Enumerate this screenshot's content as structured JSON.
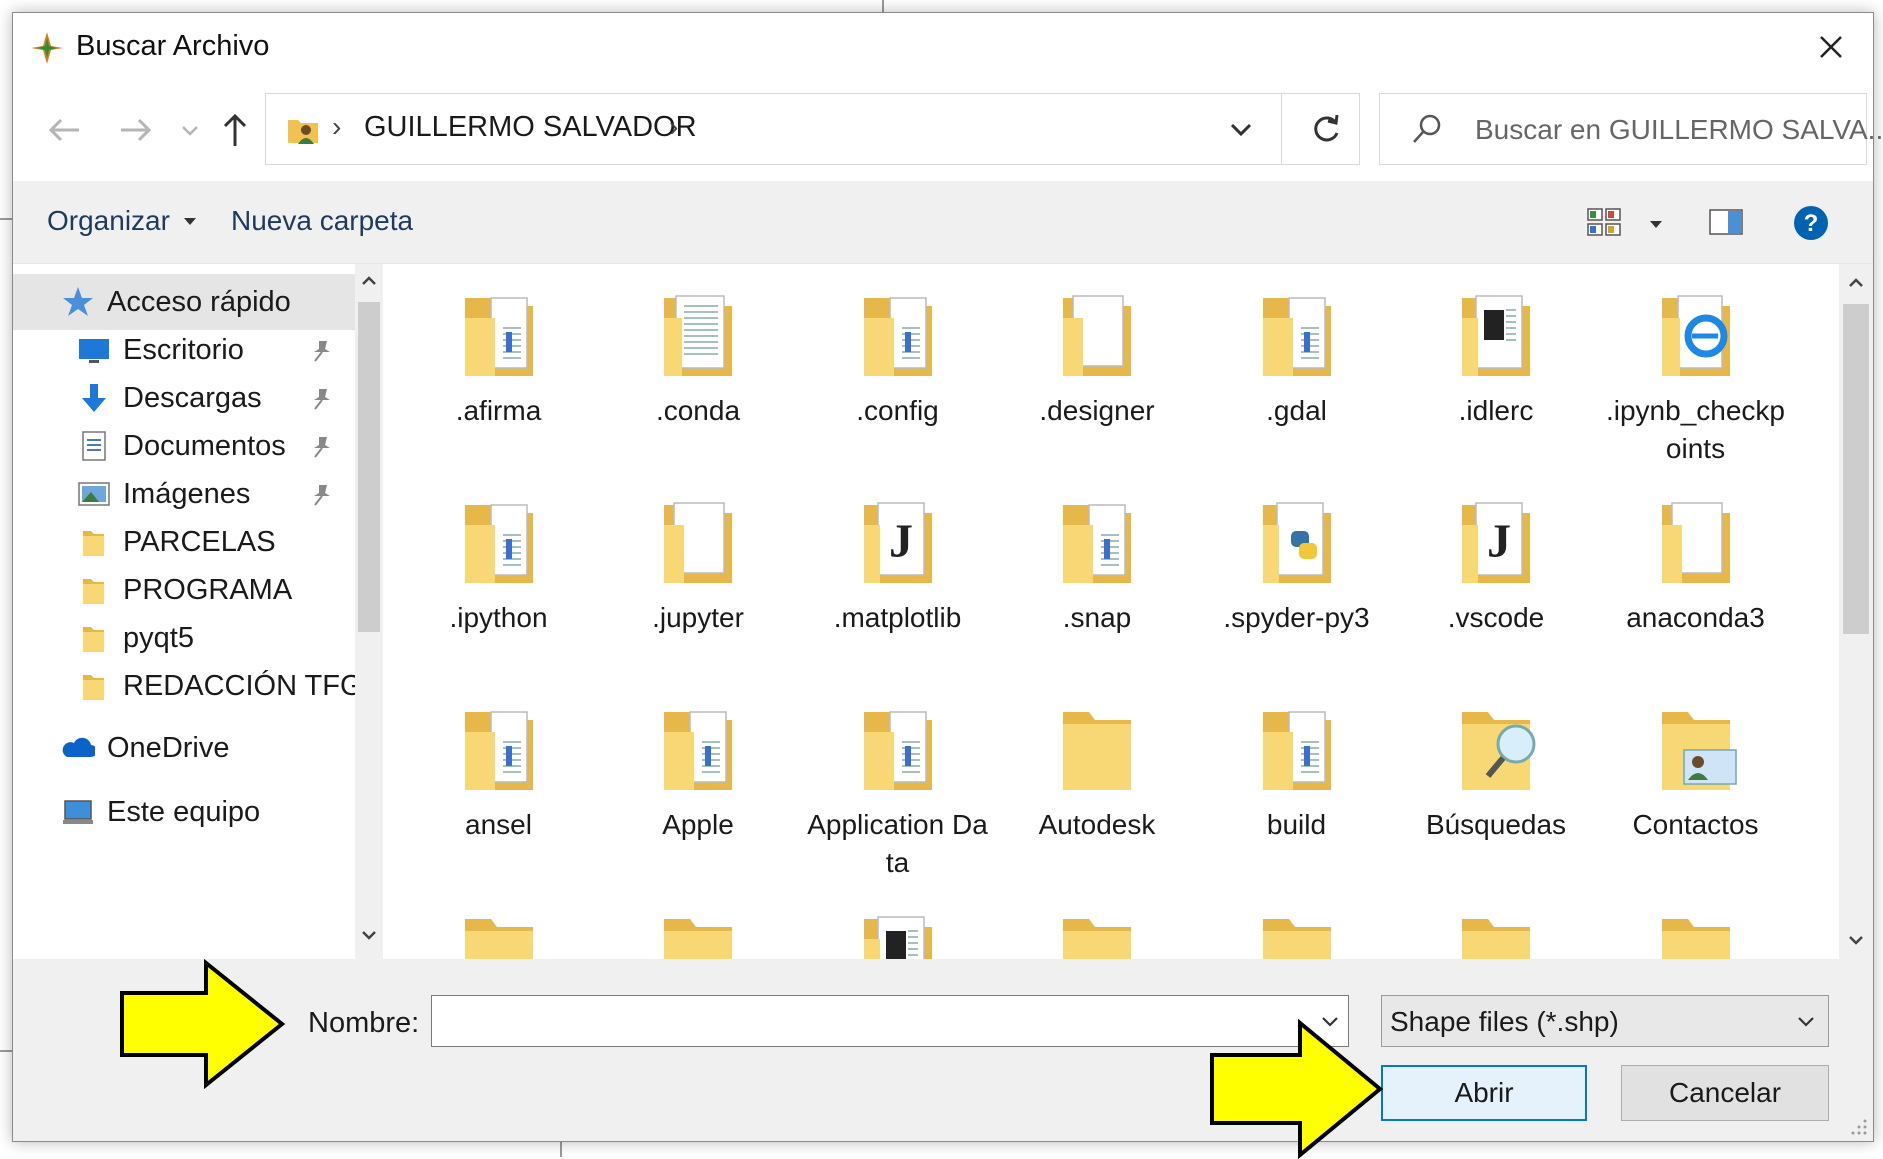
{
  "window": {
    "title": "Buscar Archivo"
  },
  "address": {
    "folder": "GUILLERMO SALVADOR"
  },
  "search": {
    "placeholder": "Buscar en GUILLERMO SALVA..."
  },
  "toolbar": {
    "organize": "Organizar",
    "new_folder": "Nueva carpeta"
  },
  "nav_pane": {
    "items": [
      {
        "label": "Acceso rápido",
        "icon": "star-icon",
        "pinned": false,
        "selected": true
      },
      {
        "label": "Escritorio",
        "icon": "desktop-icon",
        "pinned": true
      },
      {
        "label": "Descargas",
        "icon": "download-icon",
        "pinned": true
      },
      {
        "label": "Documentos",
        "icon": "documents-icon",
        "pinned": true
      },
      {
        "label": "Imágenes",
        "icon": "pictures-icon",
        "pinned": true
      },
      {
        "label": "PARCELAS",
        "icon": "folder-icon",
        "pinned": false
      },
      {
        "label": "PROGRAMA",
        "icon": "folder-icon",
        "pinned": false
      },
      {
        "label": "pyqt5",
        "icon": "folder-icon",
        "pinned": false
      },
      {
        "label": "REDACCIÓN TFG",
        "icon": "folder-icon",
        "pinned": false
      },
      {
        "label": "OneDrive",
        "icon": "onedrive-icon",
        "pinned": false
      },
      {
        "label": "Este equipo",
        "icon": "computer-icon",
        "pinned": false
      }
    ]
  },
  "files": [
    {
      "name": ".afirma",
      "icon": "folder-docs-icon"
    },
    {
      "name": ".conda",
      "icon": "folder-text-icon"
    },
    {
      "name": ".config",
      "icon": "folder-docs-icon"
    },
    {
      "name": ".designer",
      "icon": "folder-blank-icon"
    },
    {
      "name": ".gdal",
      "icon": "folder-docs-icon"
    },
    {
      "name": ".idlerc",
      "icon": "folder-doc-icon"
    },
    {
      "name": ".ipynb_checkpoints",
      "icon": "folder-ie-icon"
    },
    {
      "name": ".ipython",
      "icon": "folder-docs-icon"
    },
    {
      "name": ".jupyter",
      "icon": "folder-blank-icon"
    },
    {
      "name": ".matplotlib",
      "icon": "folder-dark-doc-icon"
    },
    {
      "name": ".snap",
      "icon": "folder-docs-icon"
    },
    {
      "name": ".spyder-py3",
      "icon": "folder-python-icon"
    },
    {
      "name": ".vscode",
      "icon": "folder-dark-doc-icon"
    },
    {
      "name": "anaconda3",
      "icon": "folder-blank-icon"
    },
    {
      "name": "ansel",
      "icon": "folder-docs-icon"
    },
    {
      "name": "Apple",
      "icon": "folder-docs-icon"
    },
    {
      "name": "Application Data",
      "icon": "folder-docs-icon"
    },
    {
      "name": "Autodesk",
      "icon": "folder-icon"
    },
    {
      "name": "build",
      "icon": "folder-docs-icon"
    },
    {
      "name": "Búsquedas",
      "icon": "search-folder-icon"
    },
    {
      "name": "Contactos",
      "icon": "contacts-folder-icon"
    },
    {
      "name": "",
      "icon": "folder-icon"
    },
    {
      "name": "",
      "icon": "folder-icon"
    },
    {
      "name": "",
      "icon": "folder-doc-icon"
    },
    {
      "name": "",
      "icon": "folder-icon"
    },
    {
      "name": "",
      "icon": "folder-icon"
    },
    {
      "name": "",
      "icon": "folder-icon"
    },
    {
      "name": "",
      "icon": "folder-icon"
    }
  ],
  "filename": {
    "label": "Nombre:",
    "value": ""
  },
  "filter": {
    "selected": "Shape files (*.shp)"
  },
  "buttons": {
    "open": "Abrir",
    "cancel": "Cancelar"
  },
  "colors": {
    "accent": "#0078d7",
    "folder": "#f8d775",
    "annotation_arrow": "#ffff00"
  }
}
